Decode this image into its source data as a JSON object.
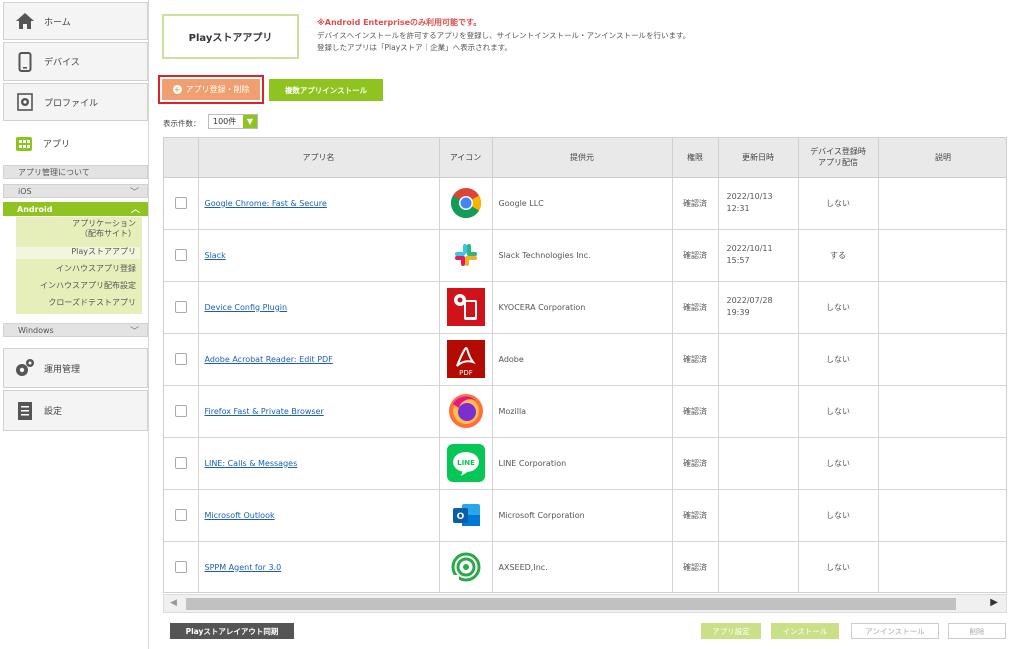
{
  "sidebar": {
    "home": "ホーム",
    "device": "デバイス",
    "profile": "プロファイル",
    "app": "アプリ",
    "app_about": "アプリ管理について",
    "ios": "iOS",
    "android": "Android",
    "android_items": [
      "アプリケーション\n（配布サイト）",
      "Playストアアプリ",
      "インハウスアプリ登録",
      "インハウスアプリ配布設定",
      "クローズドテストアプリ"
    ],
    "windows": "Windows",
    "ops": "運用管理",
    "settings": "設定"
  },
  "main": {
    "page_title": "Playストアアプリ",
    "notice_title": "※Android Enterpriseのみ利用可能です。",
    "notice_body": "デバイスへインストールを許可するアプリを登録し、サイレントインストール・アンインストールを行います。登録したアプリは「Playストア｜企業」へ表示されます。",
    "btn_add": "アプリ登録・削除",
    "btn_multi": "複数アプリインストール",
    "count_label": "表示件数：",
    "count_value": "100件",
    "columns": [
      "",
      "アプリ名",
      "アイコン",
      "提供元",
      "権限",
      "更新日時",
      "デバイス登録時\nアプリ配信",
      "説明"
    ],
    "rows": [
      {
        "name": "Google Chrome: Fast & Secure",
        "provider": "Google LLC",
        "perm": "確認済",
        "updated": "2022/10/13\n12:31",
        "deliver": "しない",
        "icon": "chrome-icon"
      },
      {
        "name": "Slack",
        "provider": "Slack Technologies Inc.",
        "perm": "確認済",
        "updated": "2022/10/11\n15:57",
        "deliver": "する",
        "icon": "slack-icon"
      },
      {
        "name": "Device Config Plugin",
        "provider": "KYOCERA Corporation",
        "perm": "確認済",
        "updated": "2022/07/28\n19:39",
        "deliver": "しない",
        "icon": "device-config-icon"
      },
      {
        "name": "Adobe Acrobat Reader: Edit PDF",
        "provider": "Adobe",
        "perm": "確認済",
        "updated": "",
        "deliver": "しない",
        "icon": "acrobat-icon"
      },
      {
        "name": "Firefox Fast & Private Browser",
        "provider": "Mozilla",
        "perm": "確認済",
        "updated": "",
        "deliver": "しない",
        "icon": "firefox-icon"
      },
      {
        "name": "LINE: Calls & Messages",
        "provider": "LINE Corporation",
        "perm": "確認済",
        "updated": "",
        "deliver": "しない",
        "icon": "line-icon"
      },
      {
        "name": "Microsoft Outlook",
        "provider": "Microsoft Corporation",
        "perm": "確認済",
        "updated": "",
        "deliver": "しない",
        "icon": "outlook-icon"
      },
      {
        "name": "SPPM Agent for 3.0",
        "provider": "AXSEED,Inc.",
        "perm": "確認済",
        "updated": "",
        "deliver": "しない",
        "icon": "sppm-icon"
      }
    ],
    "pdf_label": "PDF",
    "line_label": "LINE",
    "outlook_label": "O",
    "btn_sync": "Playストアレイアウト同期",
    "btn_app_settings": "アプリ設定",
    "btn_install": "インストール",
    "btn_uninstall": "アンインストール",
    "btn_delete": "削除"
  },
  "colors": {
    "accent_green": "#8fc31f",
    "add_orange": "#f0a070",
    "highlight_red": "#d9252a",
    "link_blue": "#1a5fb4"
  }
}
